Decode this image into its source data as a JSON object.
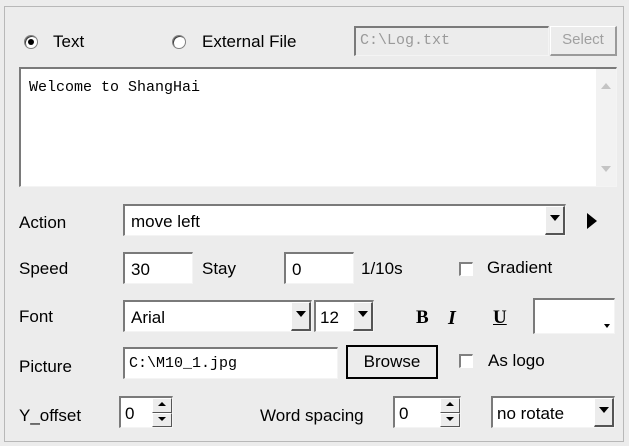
{
  "source": {
    "text_option": "Text",
    "file_option": "External File",
    "selected": "text",
    "file_path": "C:\\Log.txt",
    "select_button": "Select"
  },
  "message": {
    "text": "Welcome to ShangHai"
  },
  "action": {
    "label": "Action",
    "value": "move left"
  },
  "speed": {
    "label": "Speed",
    "value": "30"
  },
  "stay": {
    "label": "Stay",
    "value": "0",
    "unit": "1/10s"
  },
  "gradient": {
    "label": "Gradient",
    "checked": false
  },
  "font": {
    "label": "Font",
    "family": "Arial",
    "size": "12",
    "bold_label": "B",
    "italic_label": "I",
    "underline_label": "U",
    "color": "#ffffff"
  },
  "picture": {
    "label": "Picture",
    "path": "C:\\M10_1.jpg",
    "browse_button": "Browse",
    "as_logo_label": "As logo",
    "as_logo_checked": false
  },
  "offset": {
    "label": "Y_offset",
    "value": "0"
  },
  "spacing": {
    "label": "Word spacing",
    "value": "0"
  },
  "rotate": {
    "value": "no rotate"
  },
  "icons": {
    "play": "play-arrow-icon"
  }
}
